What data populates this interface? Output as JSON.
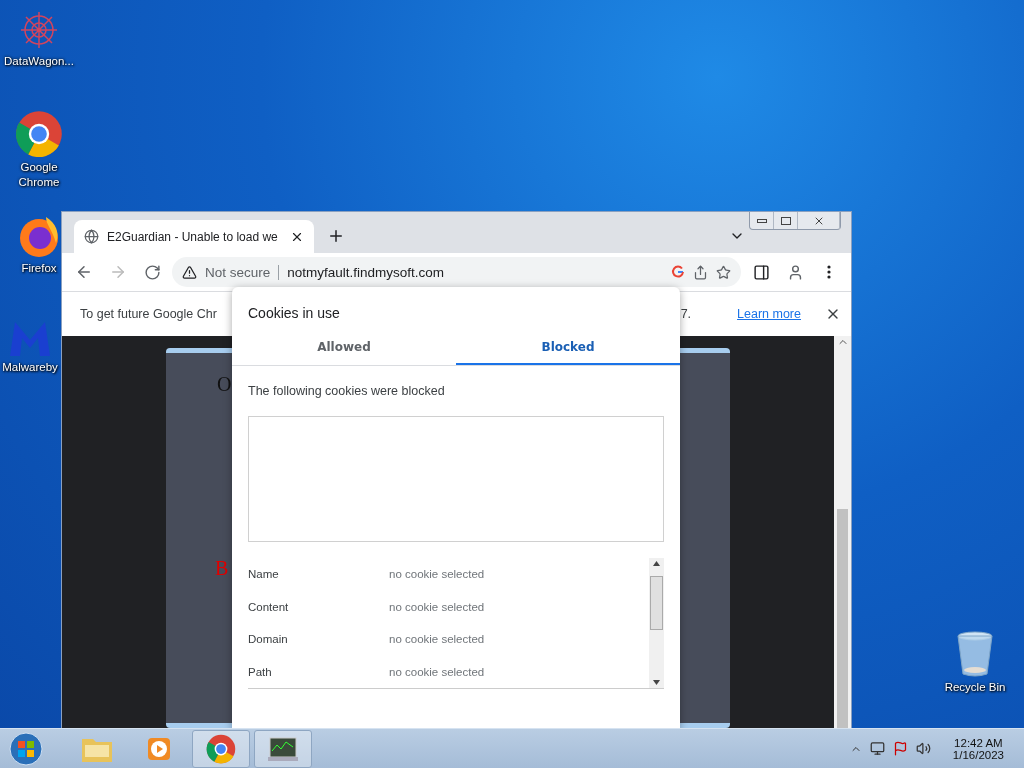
{
  "desktop_icons": [
    {
      "label": "DataWagon...",
      "kind": "web"
    },
    {
      "label": "Google\nChrome",
      "kind": "chrome"
    },
    {
      "label": "Firefox",
      "kind": "firefox"
    },
    {
      "label": "Malwareby",
      "kind": "malware"
    },
    {
      "label": "Recycle Bin",
      "kind": "bin"
    }
  ],
  "browser": {
    "tabs": [
      {
        "title": "E2Guardian - Unable to load we",
        "selected": true
      }
    ],
    "address": {
      "security": "Not secure",
      "url": "notmyfault.findmysoft.com"
    },
    "infobar": {
      "text": "To get future Google Chr",
      "text_end": "7.",
      "link": "Learn more"
    },
    "page_fragments": [
      {
        "text": "O",
        "kind": "dark"
      },
      {
        "text": "B",
        "kind": "red"
      }
    ]
  },
  "cookies_popup": {
    "title": "Cookies in use",
    "tabs": [
      {
        "label": "Allowed",
        "selected": false
      },
      {
        "label": "Blocked",
        "selected": true
      }
    ],
    "message": "The following cookies were blocked",
    "details": [
      {
        "label": "Name",
        "value": "no cookie selected"
      },
      {
        "label": "Content",
        "value": "no cookie selected"
      },
      {
        "label": "Domain",
        "value": "no cookie selected"
      },
      {
        "label": "Path",
        "value": "no cookie selected"
      }
    ]
  },
  "taskbar": {
    "apps": [
      {
        "kind": "explorer",
        "selected": false
      },
      {
        "kind": "media",
        "selected": false
      },
      {
        "kind": "chrome",
        "selected": true
      },
      {
        "kind": "monitor",
        "selected": true
      }
    ],
    "time": "12:42 AM",
    "date": "1/16/2023"
  }
}
